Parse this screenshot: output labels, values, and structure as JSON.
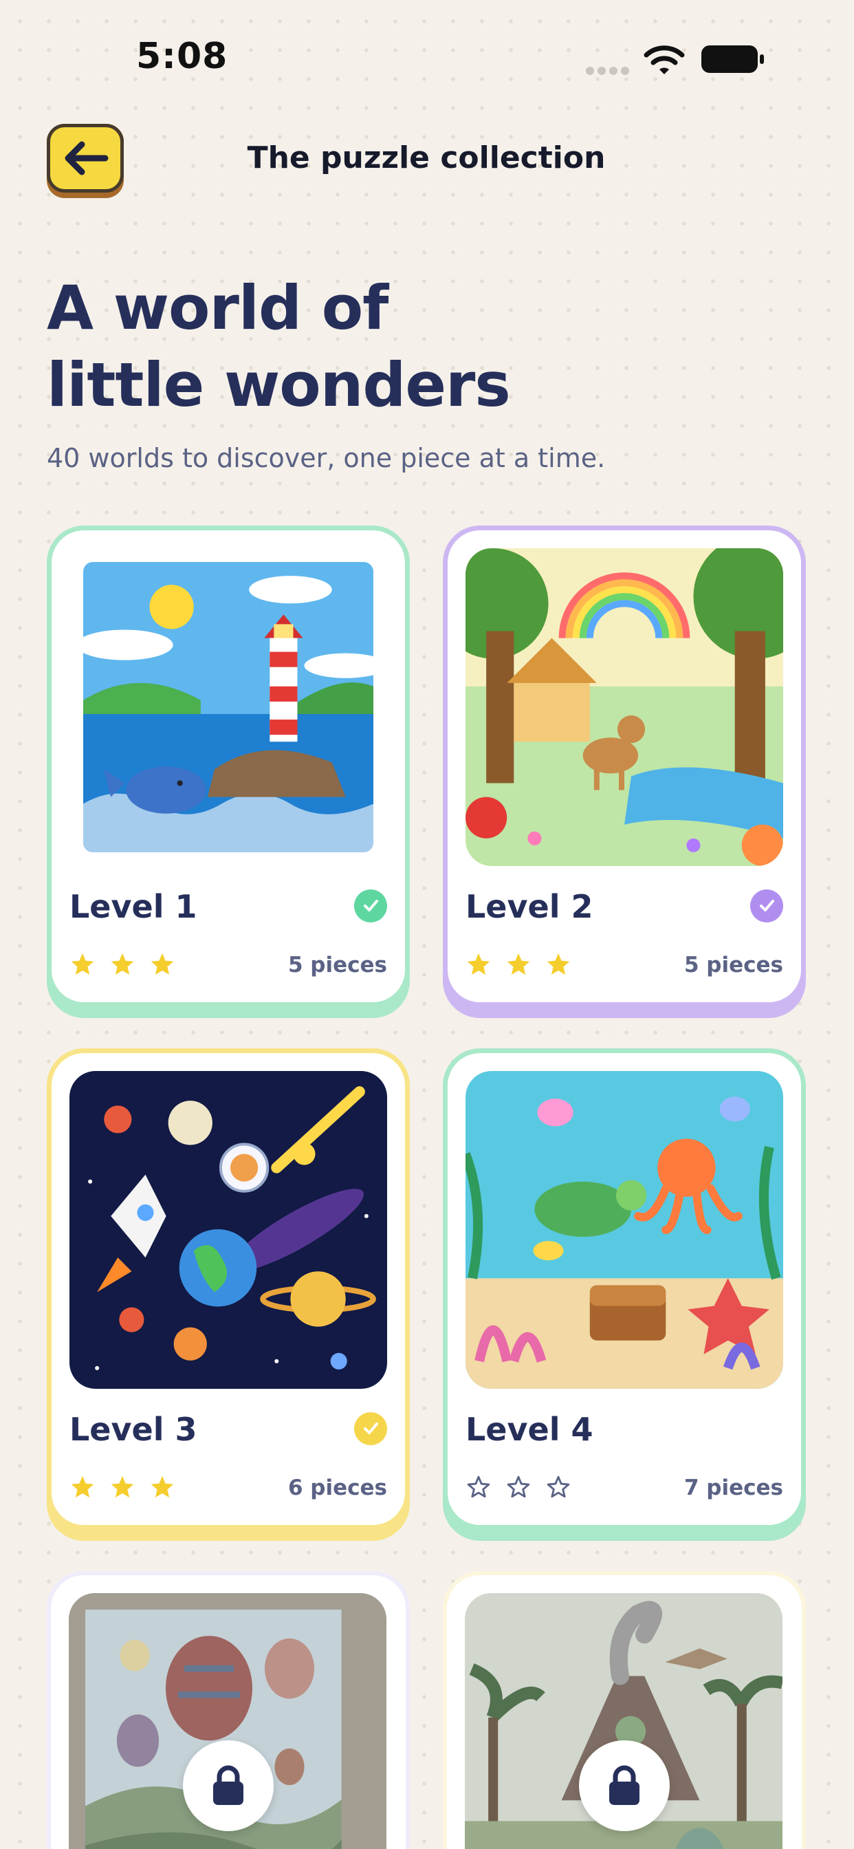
{
  "status_bar": {
    "time": "5:08"
  },
  "header": {
    "title": "The puzzle collection"
  },
  "hero": {
    "title_line1": "A world of",
    "title_line2": "little wonders",
    "subtitle": "40 worlds to discover, one piece at a time."
  },
  "levels": [
    {
      "title": "Level 1",
      "pieces": "5 pieces",
      "stars": 3,
      "completed": true,
      "color": "#5ed6a0"
    },
    {
      "title": "Level 2",
      "pieces": "5 pieces",
      "stars": 3,
      "completed": true,
      "color": "#b08ef0"
    },
    {
      "title": "Level 3",
      "pieces": "6 pieces",
      "stars": 3,
      "completed": true,
      "color": "#f5d64a"
    },
    {
      "title": "Level 4",
      "pieces": "7 pieces",
      "stars": 0,
      "completed": false,
      "color": "#5ed6a0"
    },
    {
      "locked": true
    },
    {
      "locked": true
    }
  ],
  "colors": {
    "navy": "#262f5a",
    "star": "#f5ce2e",
    "muted": "#5a6285"
  },
  "icons": {
    "back": "arrow-left-icon",
    "lock": "lock-icon",
    "check": "check-icon",
    "star": "star-icon",
    "wifi": "wifi-icon",
    "battery": "battery-icon"
  }
}
